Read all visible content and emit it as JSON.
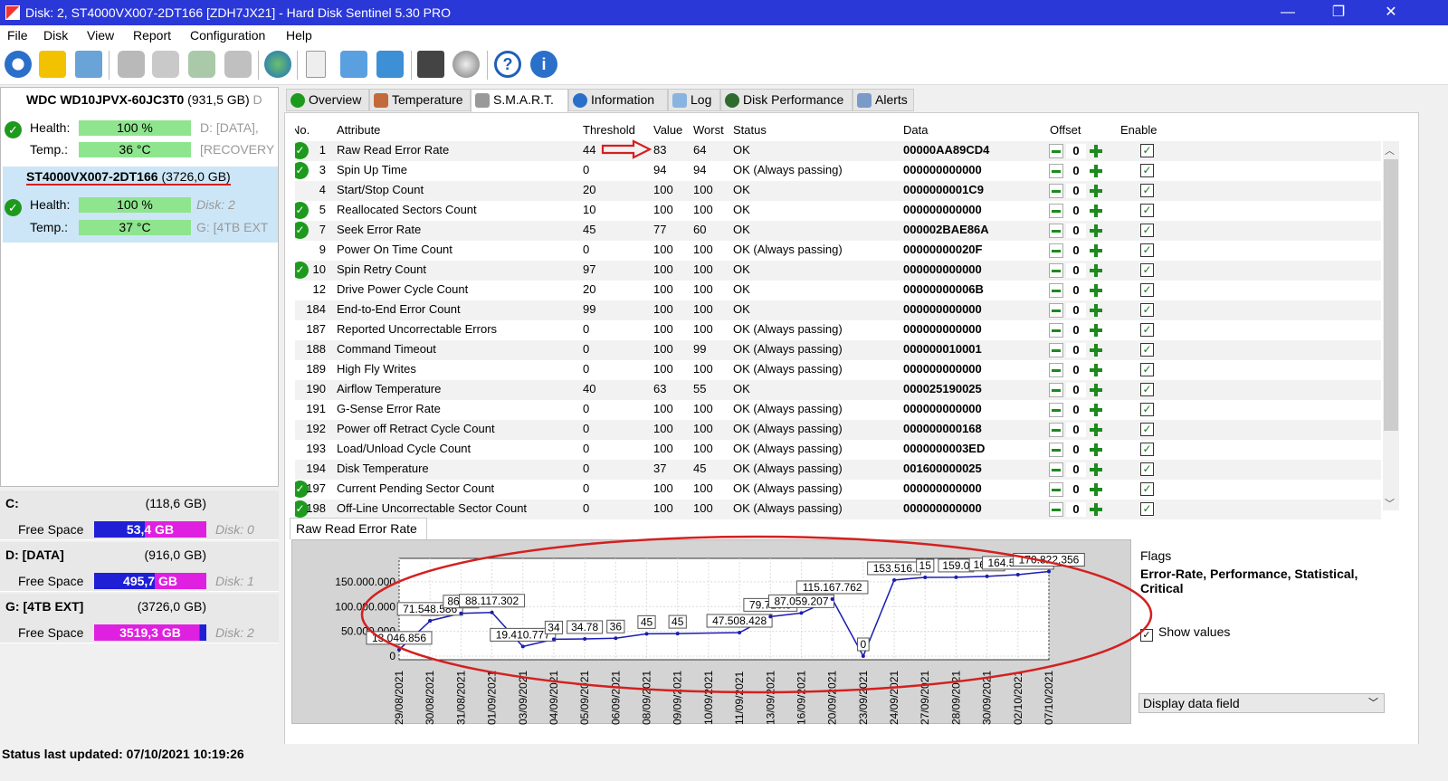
{
  "window": {
    "title": "Disk: 2, ST4000VX007-2DT166 [ZDH7JX21] - Hard Disk Sentinel 5.30 PRO",
    "minimize": "—",
    "maximize": "❐",
    "close": "✕"
  },
  "menu": [
    "File",
    "Disk",
    "View",
    "Report",
    "Configuration",
    "Help"
  ],
  "disks": [
    {
      "name": "WDC WD10JPVX-60JC3T0",
      "size": "(931,5 GB)",
      "extra": "D",
      "health_label": "Health:",
      "health": "100 %",
      "health_pct": 100,
      "temp_label": "Temp.:",
      "temp": "36 °C",
      "side1": "D: [DATA],",
      "side2": "[RECOVERY"
    },
    {
      "name": "ST4000VX007-2DT166",
      "size": "(3726,0 GB)",
      "health_label": "Health:",
      "health": "100 %",
      "health_pct": 100,
      "temp_label": "Temp.:",
      "temp": "37 °C",
      "side1": "Disk: 2",
      "side2": "G: [4TB EXT"
    }
  ],
  "volumes": [
    {
      "name": "C:",
      "size": "(118,6 GB)",
      "free_label": "Free Space",
      "free": "53,4 GB",
      "free_ratio": 0.45,
      "disk": "Disk: 0"
    },
    {
      "name": "D: [DATA]",
      "size": "(916,0 GB)",
      "free_label": "Free Space",
      "free": "495,7 GB",
      "free_ratio": 0.54,
      "disk": "Disk: 1"
    },
    {
      "name": "G: [4TB EXT]",
      "size": "(3726,0 GB)",
      "free_label": "Free Space",
      "free": "3519,3 GB",
      "free_ratio": 0.94,
      "disk": "Disk: 2"
    }
  ],
  "tabs": [
    "Overview",
    "Temperature",
    "S.M.A.R.T.",
    "Information",
    "Log",
    "Disk Performance",
    "Alerts"
  ],
  "columns": [
    "No.",
    "Attribute",
    "Threshold",
    "Value",
    "Worst",
    "Status",
    "Data",
    "Offset",
    "Enable"
  ],
  "rows": [
    {
      "ok": true,
      "no": "1",
      "attr": "Raw Read Error Rate",
      "thr": "44",
      "val": "83",
      "worst": "64",
      "status": "OK",
      "data": "00000AA89CD4",
      "offset": "0"
    },
    {
      "ok": true,
      "no": "3",
      "attr": "Spin Up Time",
      "thr": "0",
      "val": "94",
      "worst": "94",
      "status": "OK (Always passing)",
      "data": "000000000000",
      "offset": "0"
    },
    {
      "ok": false,
      "no": "4",
      "attr": "Start/Stop Count",
      "thr": "20",
      "val": "100",
      "worst": "100",
      "status": "OK",
      "data": "0000000001C9",
      "offset": "0"
    },
    {
      "ok": true,
      "no": "5",
      "attr": "Reallocated Sectors Count",
      "thr": "10",
      "val": "100",
      "worst": "100",
      "status": "OK",
      "data": "000000000000",
      "offset": "0"
    },
    {
      "ok": true,
      "no": "7",
      "attr": "Seek Error Rate",
      "thr": "45",
      "val": "77",
      "worst": "60",
      "status": "OK",
      "data": "000002BAE86A",
      "offset": "0"
    },
    {
      "ok": false,
      "no": "9",
      "attr": "Power On Time Count",
      "thr": "0",
      "val": "100",
      "worst": "100",
      "status": "OK (Always passing)",
      "data": "00000000020F",
      "offset": "0"
    },
    {
      "ok": true,
      "no": "10",
      "attr": "Spin Retry Count",
      "thr": "97",
      "val": "100",
      "worst": "100",
      "status": "OK",
      "data": "000000000000",
      "offset": "0"
    },
    {
      "ok": false,
      "no": "12",
      "attr": "Drive Power Cycle Count",
      "thr": "20",
      "val": "100",
      "worst": "100",
      "status": "OK",
      "data": "00000000006B",
      "offset": "0"
    },
    {
      "ok": false,
      "no": "184",
      "attr": "End-to-End Error Count",
      "thr": "99",
      "val": "100",
      "worst": "100",
      "status": "OK",
      "data": "000000000000",
      "offset": "0"
    },
    {
      "ok": false,
      "no": "187",
      "attr": "Reported Uncorrectable Errors",
      "thr": "0",
      "val": "100",
      "worst": "100",
      "status": "OK (Always passing)",
      "data": "000000000000",
      "offset": "0"
    },
    {
      "ok": false,
      "no": "188",
      "attr": "Command Timeout",
      "thr": "0",
      "val": "100",
      "worst": "99",
      "status": "OK (Always passing)",
      "data": "000000010001",
      "offset": "0"
    },
    {
      "ok": false,
      "no": "189",
      "attr": "High Fly Writes",
      "thr": "0",
      "val": "100",
      "worst": "100",
      "status": "OK (Always passing)",
      "data": "000000000000",
      "offset": "0"
    },
    {
      "ok": false,
      "no": "190",
      "attr": "Airflow Temperature",
      "thr": "40",
      "val": "63",
      "worst": "55",
      "status": "OK",
      "data": "000025190025",
      "offset": "0"
    },
    {
      "ok": false,
      "no": "191",
      "attr": "G-Sense Error Rate",
      "thr": "0",
      "val": "100",
      "worst": "100",
      "status": "OK (Always passing)",
      "data": "000000000000",
      "offset": "0"
    },
    {
      "ok": false,
      "no": "192",
      "attr": "Power off Retract Cycle Count",
      "thr": "0",
      "val": "100",
      "worst": "100",
      "status": "OK (Always passing)",
      "data": "000000000168",
      "offset": "0"
    },
    {
      "ok": false,
      "no": "193",
      "attr": "Load/Unload Cycle Count",
      "thr": "0",
      "val": "100",
      "worst": "100",
      "status": "OK (Always passing)",
      "data": "0000000003ED",
      "offset": "0"
    },
    {
      "ok": false,
      "no": "194",
      "attr": "Disk Temperature",
      "thr": "0",
      "val": "37",
      "worst": "45",
      "status": "OK (Always passing)",
      "data": "001600000025",
      "offset": "0"
    },
    {
      "ok": true,
      "no": "197",
      "attr": "Current Pending Sector Count",
      "thr": "0",
      "val": "100",
      "worst": "100",
      "status": "OK (Always passing)",
      "data": "000000000000",
      "offset": "0"
    },
    {
      "ok": true,
      "no": "198",
      "attr": "Off-Line Uncorrectable Sector Count",
      "thr": "0",
      "val": "100",
      "worst": "100",
      "status": "OK (Always passing)",
      "data": "000000000000",
      "offset": "0"
    }
  ],
  "graph": {
    "tab": "Raw Read Error Rate",
    "y_ticks": [
      "150.000.000",
      "100.000.000",
      "50.000.000",
      "0"
    ],
    "ylim": [
      0,
      190000000
    ],
    "x_ticks": [
      "29/08/2021",
      "30/08/2021",
      "31/08/2021",
      "01/09/2021",
      "03/09/2021",
      "04/09/2021",
      "05/09/2021",
      "06/09/2021",
      "08/09/2021",
      "09/09/2021",
      "10/09/2021",
      "11/09/2021",
      "13/09/2021",
      "16/09/2021",
      "20/09/2021",
      "23/09/2021",
      "24/09/2021",
      "27/09/2021",
      "28/09/2021",
      "30/09/2021",
      "02/10/2021",
      "07/10/2021"
    ],
    "points": [
      {
        "x": "29/08/2021",
        "y": 13046856,
        "label": "13.046.856"
      },
      {
        "x": "30/08/2021",
        "y": 71000000,
        "label": "71"
      },
      {
        "x": "30/08/2021",
        "y": 71548586,
        "label": "71.548.586"
      },
      {
        "x": "31/08/2021",
        "y": 86340000,
        "label": "86.34"
      },
      {
        "x": "01/09/2021",
        "y": 88117302,
        "label": "88.117.302"
      },
      {
        "x": "03/09/2021",
        "y": 19410000,
        "label": "19.410.777"
      },
      {
        "x": "04/09/2021",
        "y": 34000000,
        "label": "34"
      },
      {
        "x": "05/09/2021",
        "y": 34780000,
        "label": "34.78"
      },
      {
        "x": "06/09/2021",
        "y": 36000000,
        "label": "36"
      },
      {
        "x": "08/09/2021",
        "y": 45000000,
        "label": "45"
      },
      {
        "x": "09/09/2021",
        "y": 45500000,
        "label": "45"
      },
      {
        "x": "11/09/2021",
        "y": 47508428,
        "label": "47.508.428"
      },
      {
        "x": "13/09/2021",
        "y": 79710000,
        "label": "79.710.5"
      },
      {
        "x": "16/09/2021",
        "y": 87059207,
        "label": "87.059.207"
      },
      {
        "x": "20/09/2021",
        "y": 115167762,
        "label": "115.167.762"
      },
      {
        "x": "23/09/2021",
        "y": 0,
        "label": "0"
      },
      {
        "x": "24/09/2021",
        "y": 153516000,
        "label": "153.516."
      },
      {
        "x": "27/09/2021",
        "y": 159000000,
        "label": "15"
      },
      {
        "x": "28/09/2021",
        "y": 159100000,
        "label": "159.0"
      },
      {
        "x": "30/09/2021",
        "y": 161100000,
        "label": "161.1"
      },
      {
        "x": "02/10/2021",
        "y": 164506008,
        "label": "164.506.008"
      },
      {
        "x": "07/10/2021",
        "y": 170822356,
        "label": "170.822.356"
      }
    ]
  },
  "flags": {
    "label": "Flags",
    "value": "Error-Rate, Performance, Statistical, Critical"
  },
  "show_values": {
    "label": "Show values",
    "checked": true
  },
  "display_select": {
    "value": "Display data field"
  },
  "status": "Status last updated: 07/10/2021 10:19:26",
  "colors": {
    "title_bar": "#2b38d8",
    "health_bar": "#8ee58e",
    "ok_icon": "#1d9a1d",
    "graph_line": "#1c1cb0",
    "annotation_red": "#d42020"
  }
}
